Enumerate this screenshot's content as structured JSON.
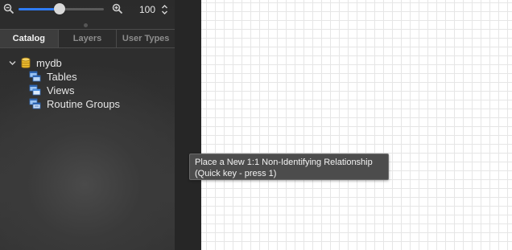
{
  "zoom": {
    "value": "100",
    "slider_level_percent": 48
  },
  "tabs": [
    {
      "label": "Catalog",
      "active": true
    },
    {
      "label": "Layers",
      "active": false
    },
    {
      "label": "User Types",
      "active": false
    }
  ],
  "tree": {
    "root": {
      "label": "mydb",
      "icon": "database-icon",
      "expanded": true
    },
    "children": [
      {
        "label": "Tables",
        "icon": "tables-icon"
      },
      {
        "label": "Views",
        "icon": "views-icon"
      },
      {
        "label": "Routine Groups",
        "icon": "routine-groups-icon"
      }
    ]
  },
  "tooltip": {
    "line1": "Place a New 1:1 Non-Identifying Relationship",
    "line2": "(Quick key - press 1)"
  },
  "colors": {
    "slider_accent": "#2f7cf6",
    "database_icon": "#e8b82e",
    "tree_node_icon": "#4a8ee0"
  }
}
